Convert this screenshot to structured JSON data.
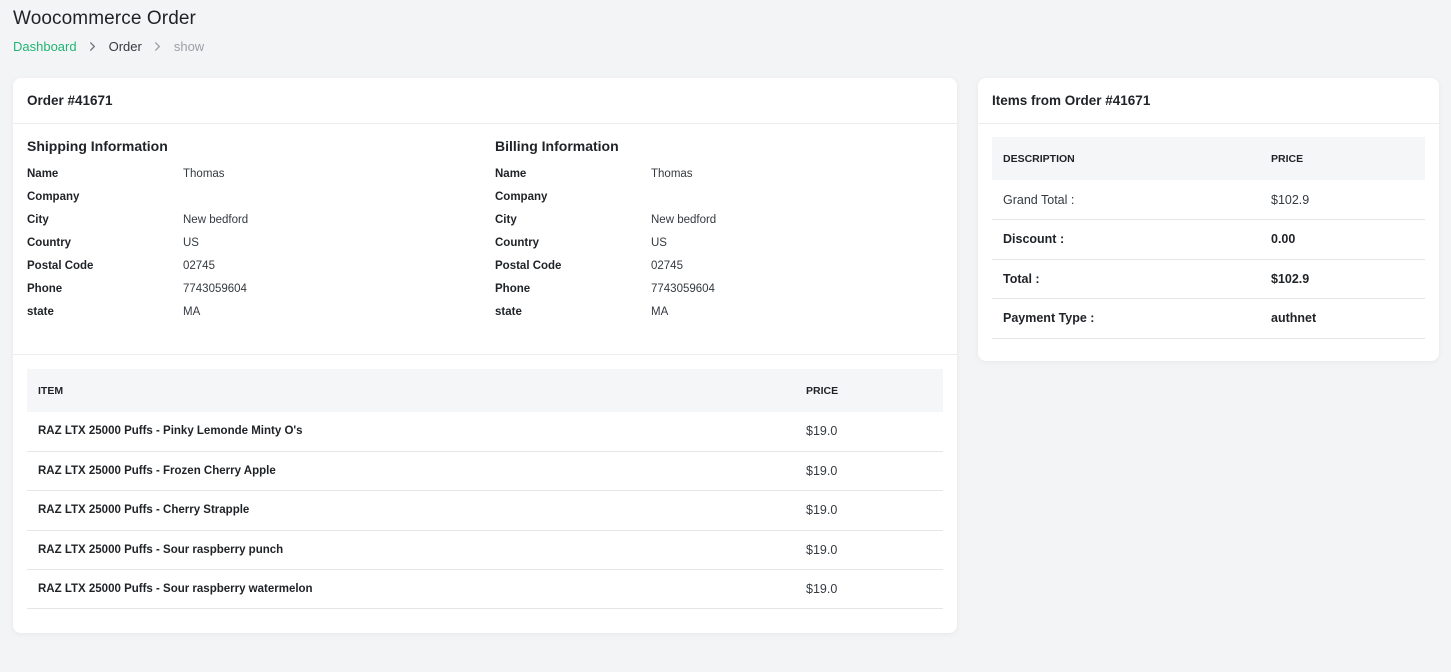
{
  "page_title": "Woocommerce Order",
  "breadcrumb": {
    "dashboard": "Dashboard",
    "order": "Order",
    "current": "show"
  },
  "order_card": {
    "title": "Order #41671",
    "shipping": {
      "title": "Shipping Information",
      "fields": [
        {
          "label": "Name",
          "value": "Thomas"
        },
        {
          "label": "Company",
          "value": ""
        },
        {
          "label": "City",
          "value": "New bedford"
        },
        {
          "label": "Country",
          "value": "US"
        },
        {
          "label": "Postal Code",
          "value": "02745"
        },
        {
          "label": "Phone",
          "value": "7743059604"
        },
        {
          "label": "state",
          "value": "MA"
        }
      ]
    },
    "billing": {
      "title": "Billing Information",
      "fields": [
        {
          "label": "Name",
          "value": "Thomas"
        },
        {
          "label": "Company",
          "value": ""
        },
        {
          "label": "City",
          "value": "New bedford"
        },
        {
          "label": "Country",
          "value": "US"
        },
        {
          "label": "Postal Code",
          "value": "02745"
        },
        {
          "label": "Phone",
          "value": "7743059604"
        },
        {
          "label": "state",
          "value": "MA"
        }
      ]
    },
    "items_table": {
      "headers": {
        "item": "ITEM",
        "price": "PRICE"
      },
      "rows": [
        {
          "item": "RAZ LTX 25000 Puffs - Pinky Lemonde Minty O's",
          "price": "$19.0"
        },
        {
          "item": "RAZ LTX 25000 Puffs - Frozen Cherry Apple",
          "price": "$19.0"
        },
        {
          "item": "RAZ LTX 25000 Puffs - Cherry Strapple",
          "price": "$19.0"
        },
        {
          "item": "RAZ LTX 25000 Puffs - Sour raspberry punch",
          "price": "$19.0"
        },
        {
          "item": "RAZ LTX 25000 Puffs - Sour raspberry watermelon",
          "price": "$19.0"
        }
      ]
    }
  },
  "summary_card": {
    "title": "Items from Order #41671",
    "headers": {
      "description": "DESCRIPTION",
      "price": "PRICE"
    },
    "rows": [
      {
        "description": "Grand Total :",
        "value": "$102.9"
      },
      {
        "description": "Discount :",
        "value": "0.00"
      },
      {
        "description": "Total :",
        "value": "$102.9"
      },
      {
        "description": "Payment Type :",
        "value": "authnet"
      }
    ]
  },
  "colors": {
    "accent": "#22b573",
    "background": "#f3f4f5",
    "header_bg": "#f5f6f8"
  }
}
